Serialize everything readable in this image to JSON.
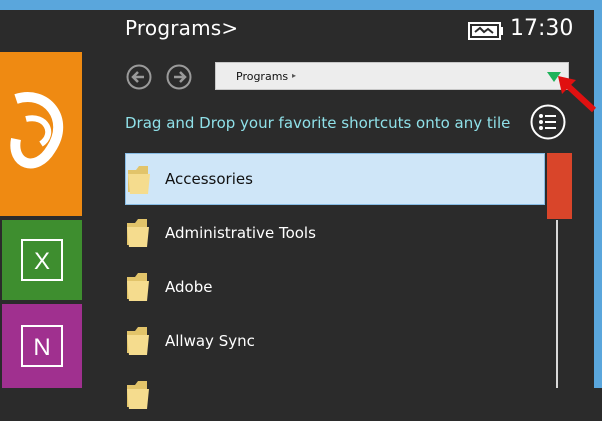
{
  "header": {
    "title": "Programs>",
    "clock": "17:30"
  },
  "icons": {
    "battery": "battery-icon",
    "back": "back-arrow-icon",
    "forward": "forward-arrow-icon",
    "dropdown": "dropdown-triangle-icon",
    "menu": "list-menu-icon",
    "folder": "folder-icon"
  },
  "path_bar": {
    "path": "Programs",
    "separator": "▸"
  },
  "hint_text": "Drag and Drop your favorite shortcuts onto any tile",
  "tiles": {
    "excel_letter": "X",
    "onenote_letter": "N"
  },
  "programs": [
    {
      "label": "Accessories"
    },
    {
      "label": "Administrative Tools"
    },
    {
      "label": "Adobe"
    },
    {
      "label": "Allway Sync"
    }
  ],
  "colors": {
    "background": "#2b2b2b",
    "accent_blue": "#5aa6dc",
    "hint": "#8fe0e8",
    "selected_row": "#cfe6f8",
    "scroll_thumb": "#d9452a",
    "excel_tile": "#3e8e2f",
    "onenote_tile": "#a0308f",
    "orange_tile": "#ef8a12"
  }
}
